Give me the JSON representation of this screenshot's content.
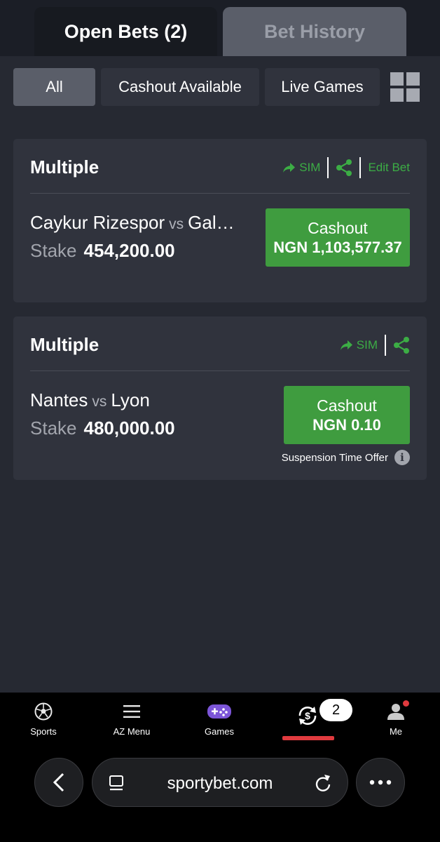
{
  "tabs": {
    "open_bets": "Open Bets (2)",
    "bet_history": "Bet History"
  },
  "filters": {
    "all": "All",
    "cashout_available": "Cashout Available",
    "live_games": "Live Games"
  },
  "bets": [
    {
      "title": "Multiple",
      "sim": "SIM",
      "edit": "Edit Bet",
      "home": "Caykur Rizespor",
      "vs": "vs",
      "away": "Gal…",
      "stake_label": "Stake",
      "stake": "454,200.00",
      "cashout_label": "Cashout",
      "cashout_amount": "NGN 1,103,577.37"
    },
    {
      "title": "Multiple",
      "sim": "SIM",
      "home": "Nantes",
      "vs": "vs",
      "away": "Lyon",
      "stake_label": "Stake",
      "stake": "480,000.00",
      "cashout_label": "Cashout",
      "cashout_amount": "NGN 0.10",
      "note": "Suspension Time Offer"
    }
  ],
  "nav": {
    "sports": "Sports",
    "az_menu": "AZ Menu",
    "games": "Games",
    "open_bets_count": "2",
    "me": "Me"
  },
  "browser": {
    "url": "sportybet.com"
  },
  "colors": {
    "accent_green": "#3f9c3f",
    "link_green": "#3cad45",
    "active_red": "#e03a3e",
    "card_bg": "#30333d",
    "page_bg": "#262932"
  },
  "icons": [
    "grid-icon",
    "share-arrow-icon",
    "share-icon",
    "info-icon",
    "soccer-ball-icon",
    "menu-icon",
    "gamepad-icon",
    "cashout-icon",
    "user-icon",
    "back-icon",
    "tabs-icon",
    "reload-icon",
    "more-icon"
  ]
}
